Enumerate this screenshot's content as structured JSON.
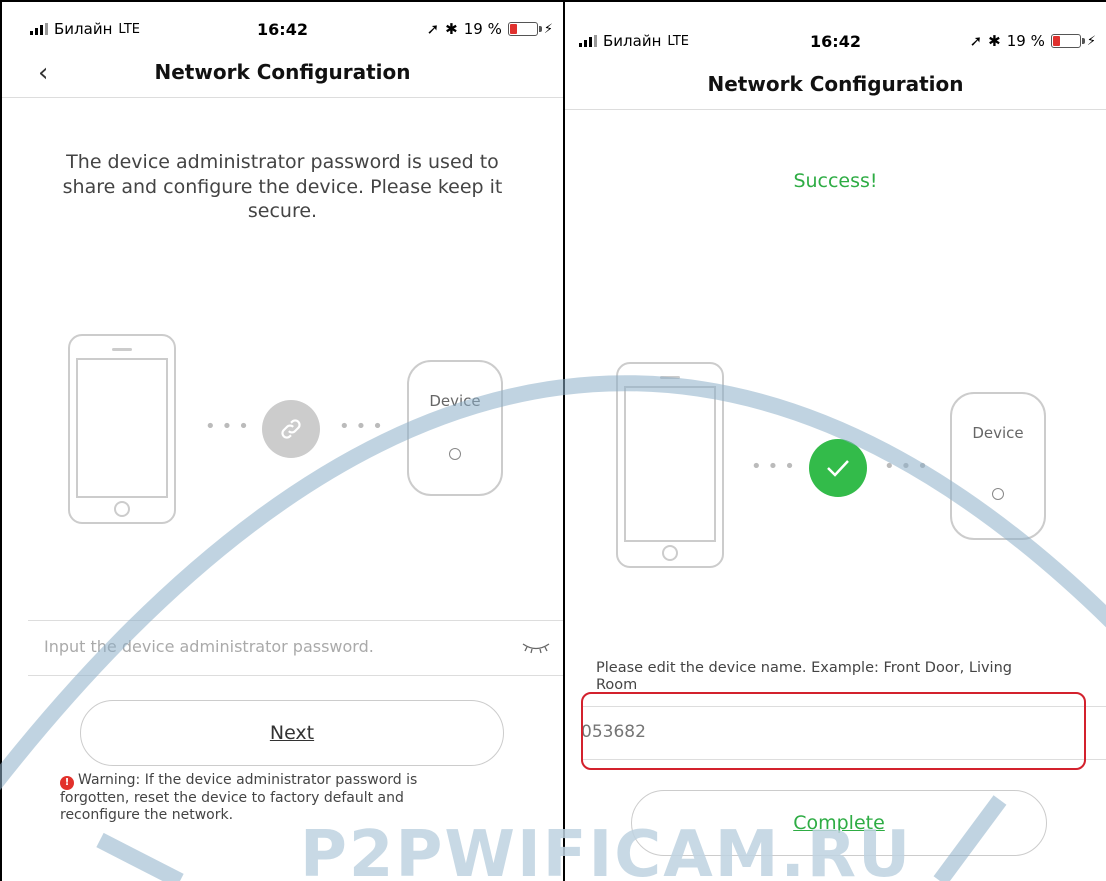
{
  "left_screen": {
    "status": {
      "carrier": "Билайн",
      "network": "LTE",
      "time": "16:42",
      "battery": "19 %",
      "battery_level": 0.19
    },
    "nav": {
      "back_icon": "‹",
      "title": "Network Configuration"
    },
    "info_text": "The device administrator password is used to share and configure the device. Please keep it secure.",
    "device_label": "Device",
    "password": {
      "placeholder": "Input the device administrator password.",
      "value": ""
    },
    "next_label": "Next",
    "warning_text": "Warning: If the device administrator password is forgotten, reset the device to factory default and reconfigure the network."
  },
  "right_screen": {
    "status": {
      "carrier": "Билайн",
      "network": "LTE",
      "time": "16:42",
      "battery": "19 %",
      "battery_level": 0.19
    },
    "nav": {
      "title": "Network Configuration"
    },
    "success_text": "Success!",
    "device_label": "Device",
    "name_hint": "Please edit the device name. Example: Front Door, Living Room",
    "device_name": {
      "placeholder": "053682",
      "value": ""
    },
    "complete_label": "Complete"
  },
  "icons": {
    "link": "link-icon",
    "check": "check-icon",
    "eye_closed": "eye-closed-icon",
    "warning": "warning-icon",
    "location": "location-arrow-icon",
    "bluetooth": "bluetooth-icon"
  },
  "colors": {
    "success_green": "#2eac44",
    "warning_red": "#e2312b",
    "highlight_red": "#d3212d",
    "battery_red": "#e0312e"
  },
  "watermark": "P2PWIFICAM.RU"
}
